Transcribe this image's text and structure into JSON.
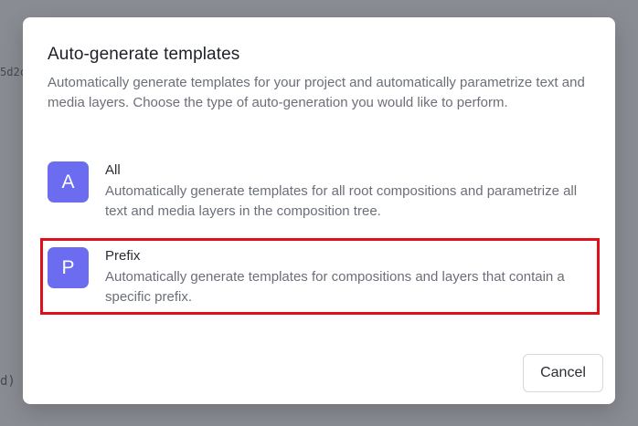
{
  "background": {
    "fragment_top": "5d2c",
    "fragment_bottom": "d) ⧉"
  },
  "modal": {
    "title": "Auto-generate templates",
    "description": "Automatically generate templates for your project and automatically parametrize text and media layers. Choose the type of auto-generation you would like to perform.",
    "options": [
      {
        "badge": "A",
        "title": "All",
        "description": "Automatically generate templates for all root compositions and parametrize all text and media layers in the composition tree."
      },
      {
        "badge": "P",
        "title": "Prefix",
        "description": "Automatically generate templates for compositions and layers that contain a specific prefix."
      }
    ],
    "cancel_label": "Cancel"
  },
  "colors": {
    "badge": "#6c6cf0",
    "highlight": "#e0101a",
    "backdrop": "#8a8c93"
  }
}
